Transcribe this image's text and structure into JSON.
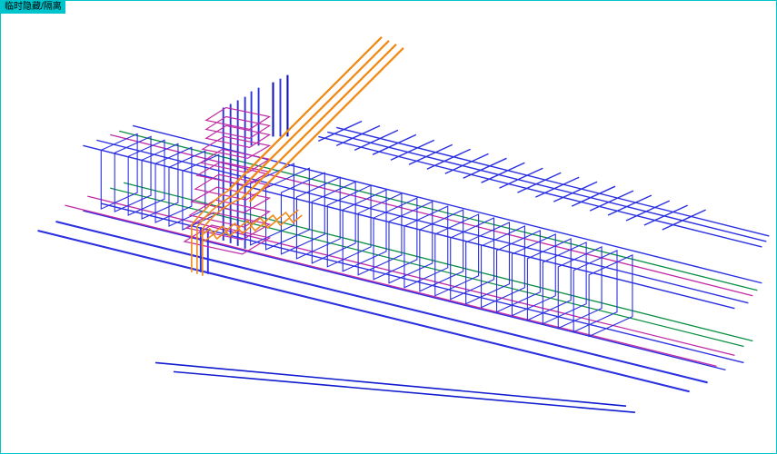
{
  "toolbar": {
    "hide_isolate_label": "临时隐藏/隔离"
  },
  "colors": {
    "frame": "#00c4cc",
    "rebar_main": "#2a2fe0",
    "rebar_column": "#2a2fe0",
    "rebar_green": "#0a8f43",
    "rebar_magenta": "#c02aa5",
    "rebar_orange": "#f08a17",
    "background": "#ffffff"
  },
  "view": {
    "description": "Isometric 3D view of reinforcing-bar (rebar) cage at a beam-column joint",
    "orientation": "axonometric",
    "components": [
      "longitudinal-beam-bars",
      "beam-stirrups",
      "column-vertical-bars",
      "column-hoops",
      "orange-diagonal-bars",
      "green-top-bars",
      "magenta-top-bars"
    ]
  }
}
